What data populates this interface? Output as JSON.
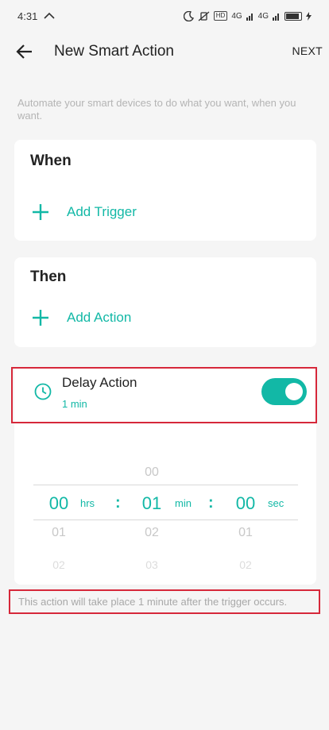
{
  "status_bar": {
    "time": "4:31",
    "network_1": "4G",
    "network_2": "4G",
    "hd": "HD",
    "battery": "100"
  },
  "header": {
    "title": "New Smart Action",
    "next_label": "NEXT"
  },
  "subtitle": "Automate your smart devices to do what you want, when you want.",
  "when_card": {
    "heading": "When",
    "add_label": "Add Trigger"
  },
  "then_card": {
    "heading": "Then",
    "add_label": "Add Action"
  },
  "delay": {
    "title": "Delay Action",
    "value": "1 min",
    "enabled": true
  },
  "picker": {
    "hours": {
      "above": "",
      "selected": "00",
      "below1": "01",
      "below2": "02",
      "unit": "hrs"
    },
    "minutes": {
      "above": "00",
      "selected": "01",
      "below1": "02",
      "below2": "03",
      "unit": "min"
    },
    "seconds": {
      "above": "",
      "selected": "00",
      "below1": "01",
      "below2": "02",
      "unit": "sec"
    },
    "separator": ":"
  },
  "note": "This action will take place 1 minute after the trigger occurs.",
  "colors": {
    "accent": "#12b8a6",
    "highlight_border": "#d6283a"
  }
}
